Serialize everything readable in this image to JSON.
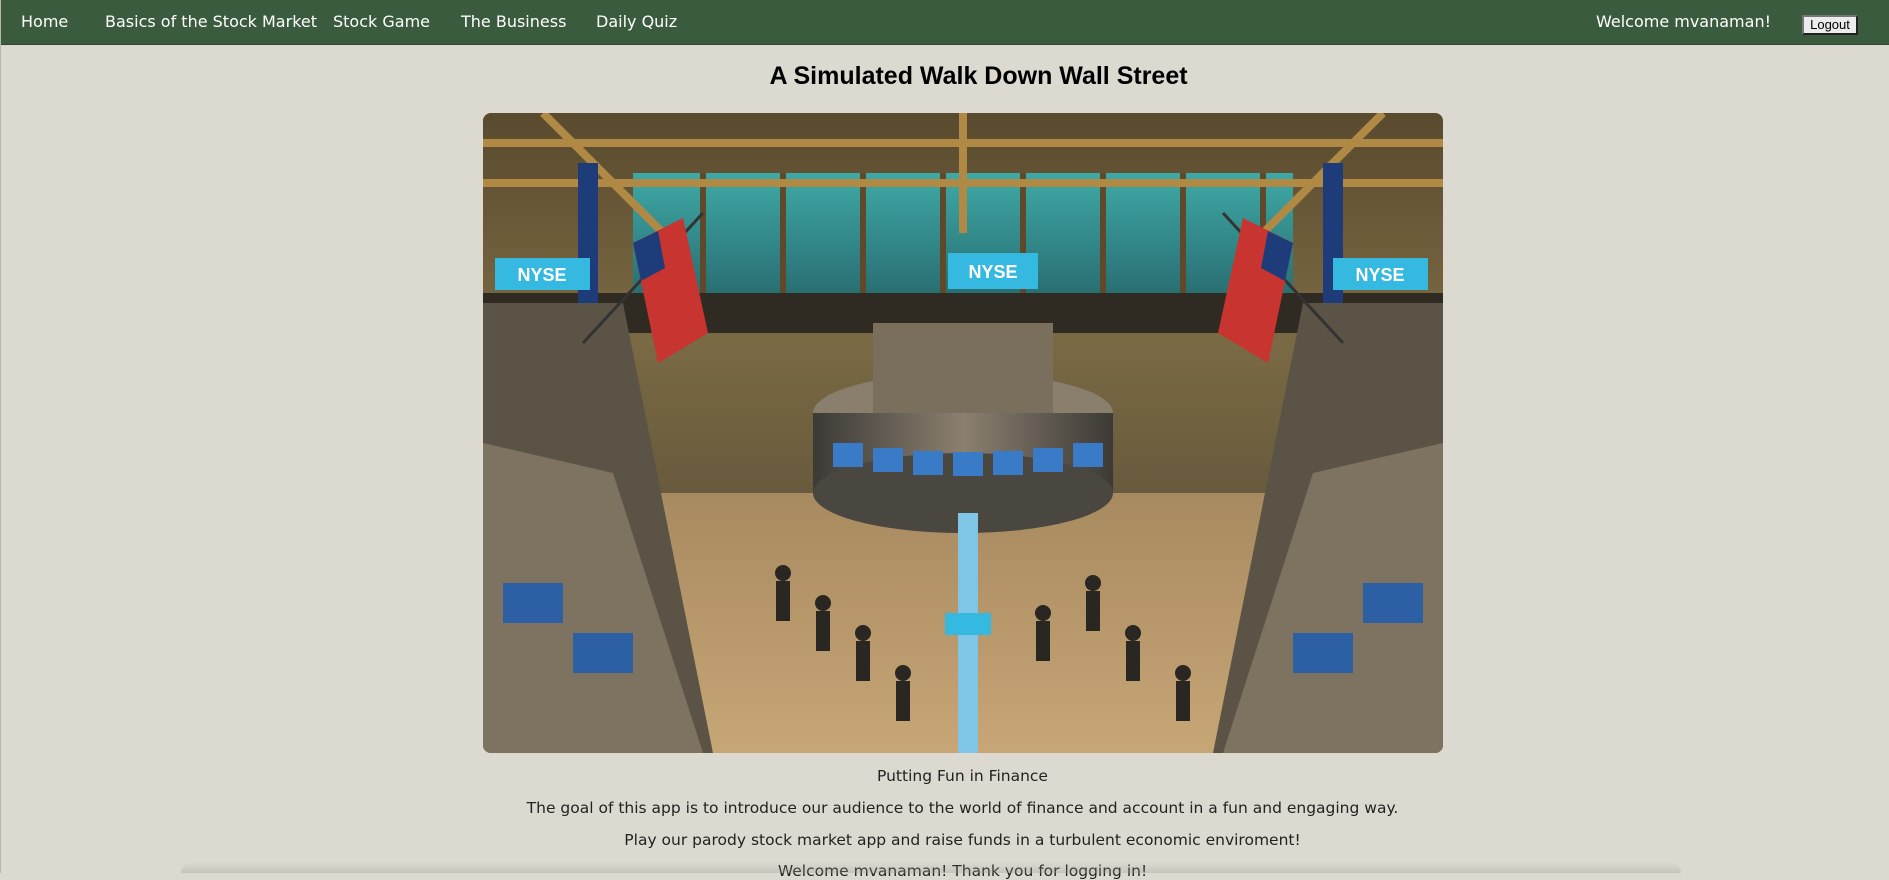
{
  "nav": {
    "items": [
      {
        "label": "Home"
      },
      {
        "label": "Basics of the Stock Market"
      },
      {
        "label": "Stock Game"
      },
      {
        "label": "The Business"
      },
      {
        "label": "Daily Quiz"
      }
    ],
    "welcome": "Welcome mvanaman!",
    "logout_label": "Logout"
  },
  "main": {
    "title": "A Simulated Walk Down Wall Street",
    "image_signage": "NYSE",
    "tagline": "Putting Fun in Finance",
    "paragraphs": [
      "The goal of this app is to introduce our audience to the world of finance and account in a fun and engaging way.",
      "Play our parody stock market app and raise funds in a turbulent economic enviroment!",
      "Welcome mvanaman! Thank you for logging in!"
    ]
  },
  "colors": {
    "navbar": "#3b5b3e",
    "background": "#dcdad0",
    "text": "#222222"
  }
}
